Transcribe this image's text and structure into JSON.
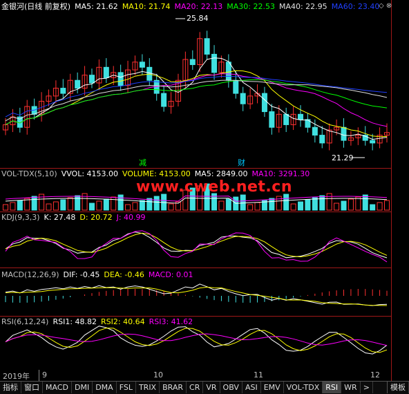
{
  "main": {
    "title": "金银河(日线 前复权)",
    "ma": [
      {
        "label": "MA5: 21.62",
        "color": "#ffffff"
      },
      {
        "label": "MA10: 21.74",
        "color": "#ffff00"
      },
      {
        "label": "MA20: 22.13",
        "color": "#ff00ff"
      },
      {
        "label": "MA30: 22.53",
        "color": "#00ff00"
      },
      {
        "label": "MA40: 22.95",
        "color": "#e0e0e0"
      },
      {
        "label": "MA60: 23.40",
        "color": "#2040ff"
      }
    ],
    "high_label": "25.84",
    "low_label": "21.29",
    "events": [
      {
        "text": "减",
        "color": "#00ff00"
      },
      {
        "text": "财",
        "color": "#00c8ff"
      }
    ],
    "close_prices": [
      21.9,
      22.2,
      21.8,
      22.6,
      22.3,
      22.8,
      23.0,
      23.3,
      23.1,
      23.6,
      23.3,
      23.8,
      23.5,
      24.1,
      23.7,
      23.9,
      23.4,
      24.0,
      24.3,
      24.1,
      23.6,
      23.1,
      22.6,
      22.8,
      23.6,
      24.4,
      24.2,
      25.2,
      24.6,
      23.9,
      24.3,
      23.6,
      23.1,
      22.7,
      23.0,
      23.1,
      22.4,
      21.8,
      22.3,
      21.9,
      22.3,
      22.1,
      21.8,
      21.5,
      21.2,
      21.7,
      21.8,
      21.3,
      21.4,
      21.5,
      21.3,
      21.2,
      21.5,
      21.6
    ]
  },
  "volume": {
    "title": "VOL-TDX(5,10)",
    "vvol": "VVOL: 4153.00",
    "volume": "VOLUME: 4153.00",
    "ma5": "MA5: 2849.00",
    "ma10": "MA10: 3291.30"
  },
  "kdj": {
    "title": "KDJ(9,3,3)",
    "k": "K: 27.48",
    "d": "D: 20.72",
    "j": "J: 40.99"
  },
  "macd": {
    "title": "MACD(12,26,9)",
    "dif": "DIF: -0.45",
    "dea": "DEA: -0.46",
    "macd": "MACD: 0.01"
  },
  "rsi": {
    "title": "RSI(6,12,24)",
    "rsi1": "RSI1: 48.82",
    "rsi2": "RSI2: 40.64",
    "rsi3": "RSI3: 41.62"
  },
  "watermark": "www.cweb.net.cn",
  "dates": {
    "year": "2019年",
    "m9": "9",
    "m10": "10",
    "m11": "11",
    "m12": "12"
  },
  "topbar": {
    "buttons": "◇ ⊗"
  },
  "tabs": [
    "指标",
    "窗口",
    "MACD",
    "DMI",
    "DMA",
    "FSL",
    "TRIX",
    "BRAR",
    "CR",
    "VR",
    "OBV",
    "ASI",
    "EMV",
    "VOL-TDX",
    "RSI",
    "WR",
    ">"
  ],
  "active_tab": "RSI",
  "mode_tab": "模板"
}
